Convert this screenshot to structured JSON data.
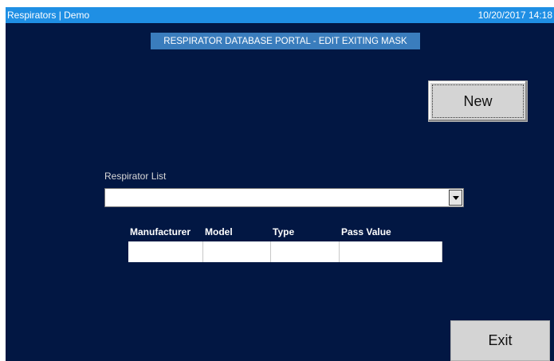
{
  "window": {
    "app_title": "Respirators | Demo",
    "datetime": "10/20/2017 14:18"
  },
  "heading": "RESPIRATOR DATABASE PORTAL - EDIT EXITING MASK",
  "buttons": {
    "new_label": "New",
    "exit_label": "Exit"
  },
  "respirator_list": {
    "label": "Respirator List",
    "selected_value": ""
  },
  "table": {
    "columns": [
      "Manufacturer",
      "Model",
      "Type",
      "Pass Value"
    ],
    "rows": [
      [
        "",
        "",
        "",
        ""
      ]
    ]
  },
  "colors": {
    "background": "#021743",
    "titlebar": "#1f8fe4",
    "heading_bg": "#3a7dbd"
  }
}
